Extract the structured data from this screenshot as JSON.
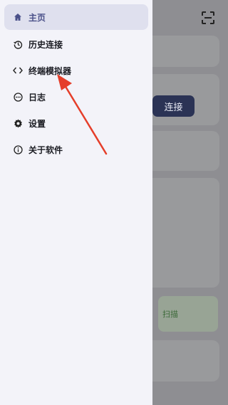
{
  "drawer": {
    "items": [
      {
        "label": "主页",
        "icon": "home-icon",
        "active": true
      },
      {
        "label": "历史连接",
        "icon": "history-icon",
        "active": false
      },
      {
        "label": "终端模拟器",
        "icon": "code-icon",
        "active": false
      },
      {
        "label": "日志",
        "icon": "log-icon",
        "active": false
      },
      {
        "label": "设置",
        "icon": "gear-icon",
        "active": false
      },
      {
        "label": "关于软件",
        "icon": "info-icon",
        "active": false
      }
    ]
  },
  "background": {
    "connect_label": "连接",
    "scan_partial_text": "扫描"
  },
  "colors": {
    "accent": "#4a5089",
    "active_bg": "#dfe0ee",
    "arrow": "#e53e2a",
    "drawer_bg": "#f3f3f9"
  }
}
